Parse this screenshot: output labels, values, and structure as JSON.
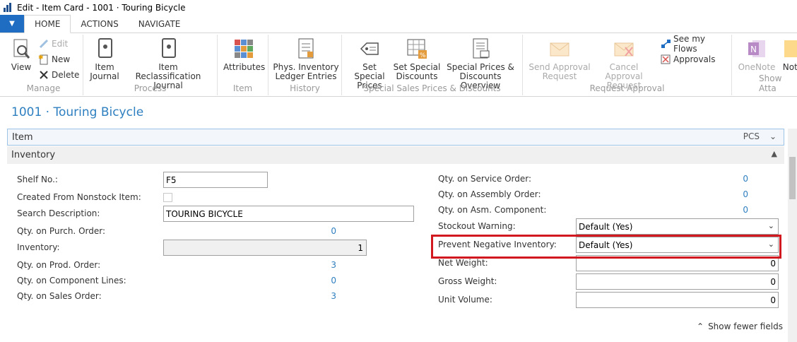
{
  "window": {
    "title": "Edit - Item Card - 1001 · Touring Bicycle"
  },
  "tabs": [
    {
      "label": "HOME",
      "active": true
    },
    {
      "label": "ACTIONS",
      "active": false
    },
    {
      "label": "NAVIGATE",
      "active": false
    }
  ],
  "ribbon": {
    "manage": {
      "label": "Manage",
      "view": "View",
      "edit": "Edit",
      "new": "New",
      "delete": "Delete"
    },
    "process": {
      "label": "Process",
      "item_journal_1": "Item",
      "item_journal_2": "Journal",
      "item_reclass_1": "Item",
      "item_reclass_2": "Reclassification Journal"
    },
    "item": {
      "label": "Item",
      "attributes": "Attributes"
    },
    "history": {
      "label": "History",
      "phys_1": "Phys. Inventory",
      "phys_2": "Ledger Entries"
    },
    "special": {
      "label": "Special Sales Prices & Discounts",
      "prices_1": "Set Special",
      "prices_2": "Prices",
      "disc_1": "Set Special",
      "disc_2": "Discounts",
      "overview_1": "Special Prices &",
      "overview_2": "Discounts Overview"
    },
    "approval": {
      "label": "Request Approval",
      "send_1": "Send Approval",
      "send_2": "Request",
      "cancel_1": "Cancel Approval",
      "cancel_2": "Request",
      "flows": "See my Flows",
      "approvals": "Approvals"
    },
    "attach": {
      "label": "Show Atta",
      "onenote": "OneNote",
      "notes": "Note"
    }
  },
  "page": {
    "title": "1001 · Touring Bicycle",
    "item_section": "Item",
    "item_uom": "PCS",
    "inventory_section": "Inventory"
  },
  "fields_left": {
    "shelf_no": {
      "label": "Shelf No.:",
      "value": "F5"
    },
    "created_from_nonstock": {
      "label": "Created From Nonstock Item:"
    },
    "search_description": {
      "label": "Search Description:",
      "value": "TOURING BICYCLE"
    },
    "qty_purch": {
      "label": "Qty. on Purch. Order:",
      "value": "0"
    },
    "inventory": {
      "label": "Inventory:",
      "value": "1"
    },
    "qty_prod": {
      "label": "Qty. on Prod. Order:",
      "value": "3"
    },
    "qty_component": {
      "label": "Qty. on Component Lines:",
      "value": "0"
    },
    "qty_sales": {
      "label": "Qty. on Sales Order:",
      "value": "3"
    }
  },
  "fields_right": {
    "qty_service": {
      "label": "Qty. on Service Order:",
      "value": "0"
    },
    "qty_assembly": {
      "label": "Qty. on Assembly Order:",
      "value": "0"
    },
    "qty_asm_component": {
      "label": "Qty. on Asm. Component:",
      "value": "0"
    },
    "stockout_warning": {
      "label": "Stockout Warning:",
      "value": "Default (Yes)"
    },
    "prevent_negative": {
      "label": "Prevent Negative Inventory:",
      "value": "Default (Yes)"
    },
    "net_weight": {
      "label": "Net Weight:",
      "value": "0"
    },
    "gross_weight": {
      "label": "Gross Weight:",
      "value": "0"
    },
    "unit_volume": {
      "label": "Unit Volume:",
      "value": "0"
    }
  },
  "footer": {
    "show_fewer": "Show fewer fields"
  },
  "colors": {
    "accent": "#2e7fc0",
    "highlight": "#d0181e",
    "file_tab": "#1f6dc2"
  }
}
